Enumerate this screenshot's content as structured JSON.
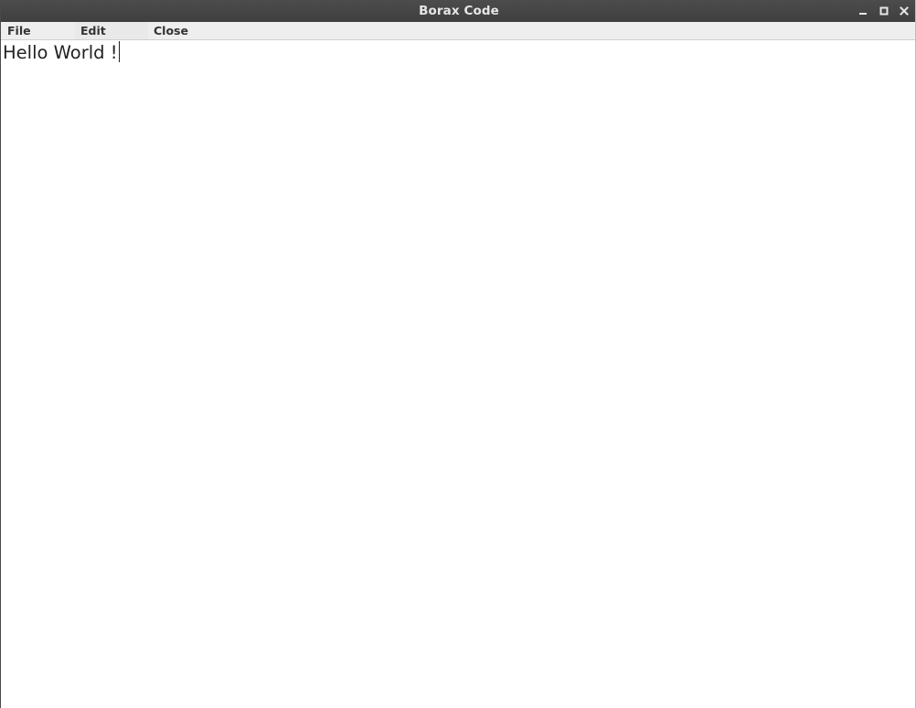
{
  "window": {
    "title": "Borax Code",
    "controls": [
      "minimize-icon",
      "maximize-icon",
      "close-icon"
    ]
  },
  "menubar": {
    "items": [
      {
        "label": "File"
      },
      {
        "label": "Edit"
      },
      {
        "label": "Close"
      }
    ]
  },
  "editor": {
    "text": "Hello World !"
  },
  "colors": {
    "titlebar": "#444444",
    "title_text": "#e6e6e6",
    "menubar": "#eeeeee",
    "editor_bg": "#ffffff",
    "text": "#222222"
  }
}
